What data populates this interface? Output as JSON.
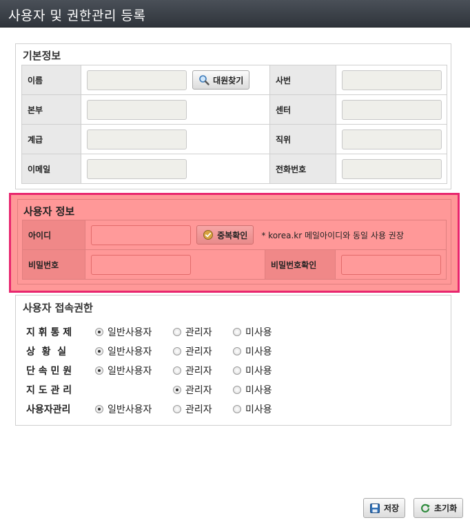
{
  "window": {
    "title": "사용자 및 권한관리 등록"
  },
  "basic_info": {
    "title": "기본정보",
    "rows": [
      {
        "left_label": "이름",
        "right_label": "사번",
        "has_search": true
      },
      {
        "left_label": "본부",
        "right_label": "센터",
        "has_search": false
      },
      {
        "left_label": "계급",
        "right_label": "직위",
        "has_search": false
      },
      {
        "left_label": "이메일",
        "right_label": "전화번호",
        "has_search": false
      }
    ],
    "search_button_label": "대원찾기",
    "search_icon": "magnifier-icon"
  },
  "user_info": {
    "title": "사용자 정보",
    "id_label": "아이디",
    "dup_check_label": "중복확인",
    "dup_check_icon": "check-circle-icon",
    "note": "* korea.kr 메일아이디와 동일 사용 권장",
    "password_label": "비밀번호",
    "password_confirm_label": "비밀번호확인",
    "highlight_color": "#e8266e"
  },
  "access": {
    "title": "사용자 접속권한",
    "options": [
      "일반사용자",
      "관리자",
      "미사용"
    ],
    "rows": [
      {
        "name": "지 휘 통 제",
        "selected": "일반사용자",
        "has_general": true
      },
      {
        "name": "상  황  실",
        "selected": "일반사용자",
        "has_general": true
      },
      {
        "name": "단 속 민 원",
        "selected": "일반사용자",
        "has_general": true
      },
      {
        "name": "지 도 관 리",
        "selected": "관리자",
        "has_general": false
      },
      {
        "name": "사용자관리",
        "selected": "일반사용자",
        "has_general": true
      }
    ]
  },
  "footer": {
    "save_label": "저장",
    "save_icon": "floppy-disk-icon",
    "reset_label": "초기화",
    "reset_icon": "refresh-icon"
  }
}
